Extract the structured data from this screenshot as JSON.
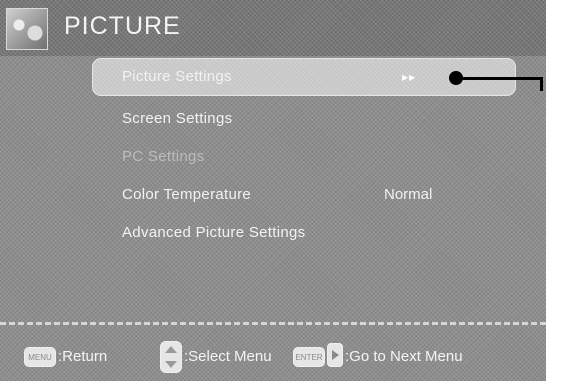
{
  "header": {
    "title": "PICTURE",
    "icon": "picture-icon"
  },
  "menu": {
    "items": [
      {
        "label": "Picture Settings",
        "state": "selected",
        "value": "▸▸"
      },
      {
        "label": "Screen Settings",
        "state": "normal",
        "value": ""
      },
      {
        "label": "PC Settings",
        "state": "disabled",
        "value": ""
      },
      {
        "label": "Color Temperature",
        "state": "normal",
        "value": "Normal"
      },
      {
        "label": "Advanced Picture Settings",
        "state": "normal",
        "value": ""
      }
    ]
  },
  "footer": {
    "menu_key_label": "MENU",
    "return_label": ":Return",
    "select_label": ":Select Menu",
    "enter_key_label": "ENTER",
    "next_label": ":Go to Next Menu"
  },
  "colors": {
    "background": "#8e8e8e",
    "highlight": "#c7c7c7",
    "text": "#f2f2f2",
    "disabled_text": "#bcbcbc"
  }
}
